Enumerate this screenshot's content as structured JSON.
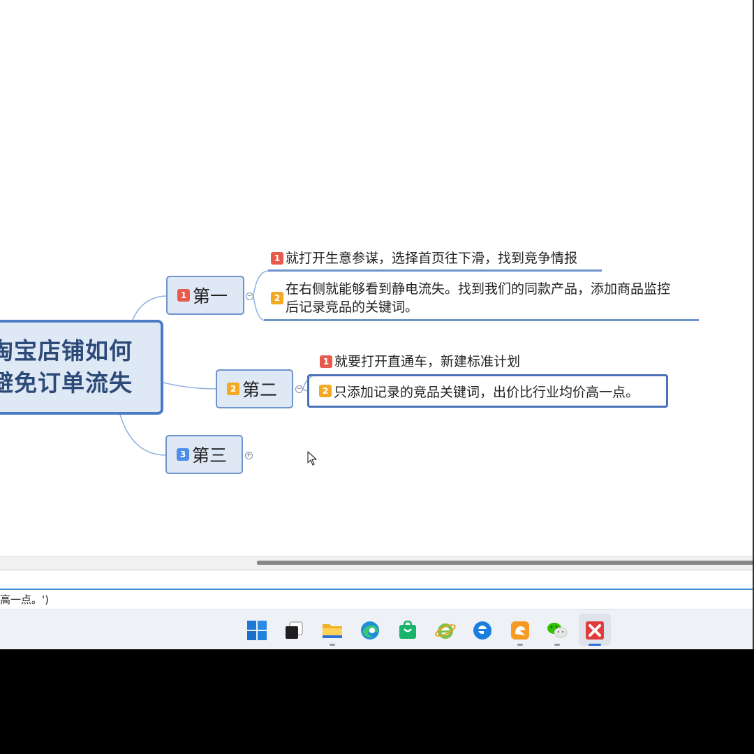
{
  "mindmap": {
    "root": {
      "line1": "淘宝店铺如何",
      "line2": "避免订单流失"
    },
    "branches": [
      {
        "badge": "1",
        "label": "第一",
        "children": [
          {
            "badge": "1",
            "text": "就打开生意参谋，选择首页往下滑，找到竞争情报"
          },
          {
            "badge": "2",
            "line1": "在右侧就能够看到静电流失。找到我们的同款产品，添加商品监控",
            "line2": "后记录竞品的关键词。"
          }
        ]
      },
      {
        "badge": "2",
        "label": "第二",
        "children": [
          {
            "badge": "1",
            "text": "就要打开直通车，新建标准计划"
          },
          {
            "badge": "2",
            "text": "只添加记录的竞品关键词，出价比行业均价高一点。"
          }
        ]
      },
      {
        "badge": "3",
        "label": "第三",
        "children": []
      }
    ],
    "toggle_collapse": "−",
    "toggle_expand": "+"
  },
  "console": {
    "text": "高一点。')"
  },
  "taskbar": {
    "icons": [
      "windows-start-icon",
      "task-view-icon",
      "file-explorer-icon",
      "edge-icon",
      "store-icon",
      "ie-icon",
      "edge-legacy-icon",
      "uc-browser-icon",
      "wechat-icon",
      "xmind-icon"
    ]
  },
  "colors": {
    "node_fill": "#dfe8f5",
    "node_border": "#4a7bc4",
    "badge_red": "#e85b4c",
    "badge_orange": "#f3a922",
    "badge_blue": "#4f8ee8",
    "taskbar_accent": "#2f6fdc"
  }
}
